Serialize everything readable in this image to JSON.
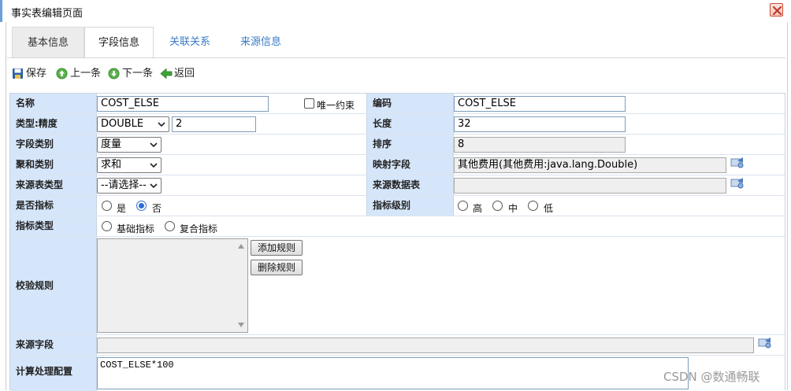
{
  "window": {
    "title": "事实表编辑页面"
  },
  "tabs": [
    {
      "label": "基本信息"
    },
    {
      "label": "字段信息"
    },
    {
      "label": "关联关系"
    },
    {
      "label": "来源信息"
    }
  ],
  "toolbar": {
    "save": "保存",
    "prev": "上一条",
    "next": "下一条",
    "back": "返回"
  },
  "form": {
    "name_label": "名称",
    "name_value": "COST_ELSE",
    "unique_label": "唯一约束",
    "unique_checked": false,
    "code_label": "编码",
    "code_value": "COST_ELSE",
    "type_label": "类型:精度",
    "type_value": "DOUBLE",
    "precision_value": "2",
    "length_label": "长度",
    "length_value": "32",
    "field_category_label": "字段类别",
    "field_category_value": "度量",
    "order_label": "排序",
    "order_value": "8",
    "agg_label": "聚和类别",
    "agg_value": "求和",
    "mapping_label": "映射字段",
    "mapping_value": "其他费用(其他费用:java.lang.Double)",
    "source_table_type_label": "来源表类型",
    "source_table_type_value": "--请选择--",
    "source_table_label": "来源数据表",
    "source_table_value": "",
    "is_indicator_label": "是否指标",
    "is_indicator_options": [
      "是",
      "否"
    ],
    "is_indicator_selected": "否",
    "indicator_level_label": "指标级别",
    "indicator_level_options": [
      "高",
      "中",
      "低"
    ],
    "indicator_type_label": "指标类型",
    "indicator_type_options": [
      "基础指标",
      "复合指标"
    ],
    "validation_label": "校验规则",
    "add_rule": "添加规则",
    "delete_rule": "删除规则",
    "source_field_label": "来源字段",
    "source_field_value": "",
    "calc_label": "计算处理配置",
    "calc_value": "COST_ELSE*100"
  },
  "watermark": "CSDN @数通畅联",
  "colors": {
    "label_bg": "#d6e6fa",
    "tab_link": "#3a7bc6",
    "accent": "#2f6fd4"
  }
}
